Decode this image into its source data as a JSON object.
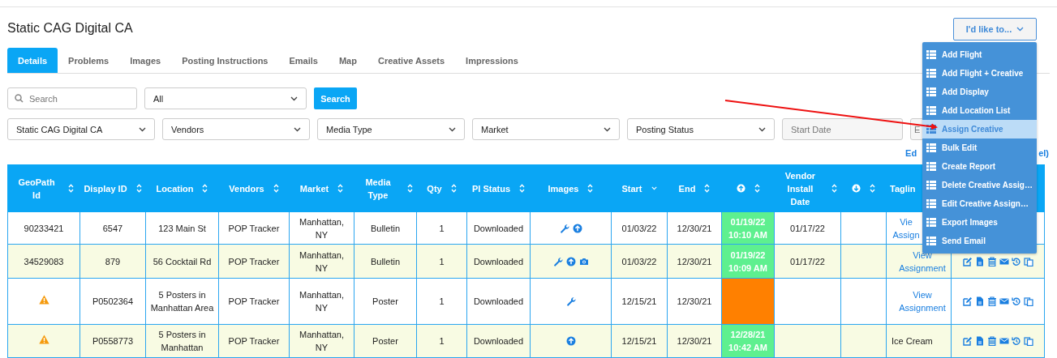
{
  "page_title": "Static CAG Digital CA",
  "action_menu": {
    "label": "I'd like to...",
    "items": [
      {
        "label": "Add Flight",
        "selected": false
      },
      {
        "label": "Add Flight + Creative",
        "selected": false
      },
      {
        "label": "Add Display",
        "selected": false
      },
      {
        "label": "Add Location List",
        "selected": false
      },
      {
        "label": "Assign Creative",
        "selected": true
      },
      {
        "label": "Bulk Edit",
        "selected": false
      },
      {
        "label": "Create Report",
        "selected": false
      },
      {
        "label": "Delete Creative Assig…",
        "selected": false
      },
      {
        "label": "Edit Creative Assign…",
        "selected": false
      },
      {
        "label": "Export Images",
        "selected": false
      },
      {
        "label": "Send Email",
        "selected": false
      }
    ]
  },
  "tabs": [
    {
      "label": "Details",
      "selected": true
    },
    {
      "label": "Problems",
      "selected": false
    },
    {
      "label": "Images",
      "selected": false
    },
    {
      "label": "Posting Instructions",
      "selected": false
    },
    {
      "label": "Emails",
      "selected": false
    },
    {
      "label": "Map",
      "selected": false
    },
    {
      "label": "Creative Assets",
      "selected": false
    },
    {
      "label": "Impressions",
      "selected": false
    }
  ],
  "search": {
    "placeholder": "Search",
    "scope": "All",
    "button": "Search"
  },
  "filters": [
    {
      "kind": "select",
      "value": "Static CAG Digital CA"
    },
    {
      "kind": "select",
      "value": "Vendors"
    },
    {
      "kind": "select",
      "value": "Media Type"
    },
    {
      "kind": "select",
      "value": "Market"
    },
    {
      "kind": "select",
      "value": "Posting Status"
    },
    {
      "kind": "date",
      "placeholder": "Start Date"
    },
    {
      "kind": "date",
      "placeholder": "E"
    }
  ],
  "links": [
    "Ed",
    "el)"
  ],
  "table": {
    "columns": [
      {
        "kind": "text",
        "label": "GeoPath Id",
        "sortable": true,
        "sorted": false
      },
      {
        "kind": "text",
        "label": "Display ID",
        "sortable": true,
        "sorted": false
      },
      {
        "kind": "text",
        "label": "Location",
        "sortable": true,
        "sorted": false
      },
      {
        "kind": "text",
        "label": "Vendors",
        "sortable": true,
        "sorted": false
      },
      {
        "kind": "text",
        "label": "Market",
        "sortable": true,
        "sorted": false
      },
      {
        "kind": "text",
        "label": "Media Type",
        "sortable": true,
        "sorted": false
      },
      {
        "kind": "text",
        "label": "Qty",
        "sortable": true,
        "sorted": false
      },
      {
        "kind": "text",
        "label": "PI Status",
        "sortable": true,
        "sorted": false
      },
      {
        "kind": "text",
        "label": "Images",
        "sortable": true,
        "sorted": false
      },
      {
        "kind": "text",
        "label": "Start",
        "sortable": true,
        "sorted": true
      },
      {
        "kind": "text",
        "label": "End",
        "sortable": true,
        "sorted": false
      },
      {
        "kind": "up",
        "sortable": true,
        "sorted": false
      },
      {
        "kind": "text",
        "label": "Vendor Install Date",
        "sortable": true,
        "sorted": false
      },
      {
        "kind": "down",
        "sortable": true,
        "sorted": false
      },
      {
        "kind": "text",
        "label": "Taglin",
        "sortable": false
      },
      {
        "kind": "blank",
        "sortable": false
      }
    ],
    "rows": [
      {
        "geopath_warning": false,
        "geopath_id": "90233421",
        "display_id": "6547",
        "location": "123 Main St",
        "vendor": "POP Tracker",
        "market": "Manhattan, NY",
        "media_type": "Bulletin",
        "qty": "1",
        "pi_status": "Downloaded",
        "images": {
          "wrench": true,
          "upload": true,
          "camera": false
        },
        "start": "01/03/22",
        "end": "12/30/21",
        "uploaded": {
          "text": "01/19/22 10:10 AM",
          "color": "#5ef08f"
        },
        "vendor_install": "01/17/22",
        "tagline": {
          "kind": "link",
          "text": "Vie Assign"
        },
        "actions": false
      },
      {
        "geopath_warning": false,
        "geopath_id": "34529083",
        "display_id": "879",
        "location": "56 Cocktail Rd",
        "vendor": "POP Tracker",
        "market": "Manhattan, NY",
        "media_type": "Bulletin",
        "qty": "1",
        "pi_status": "Downloaded",
        "images": {
          "wrench": true,
          "upload": true,
          "camera": true
        },
        "start": "01/03/22",
        "end": "12/30/21",
        "uploaded": {
          "text": "01/19/22 10:09 AM",
          "color": "#5ef08f"
        },
        "vendor_install": "01/17/22",
        "tagline": {
          "kind": "link",
          "text": "View Assignment"
        },
        "actions": true
      },
      {
        "geopath_warning": true,
        "display_id": "P0502364",
        "location": "5 Posters in Manhattan Area",
        "vendor": "POP Tracker",
        "market": "Manhattan, NY",
        "media_type": "Poster",
        "qty": "1",
        "pi_status": "Downloaded",
        "images": {
          "wrench": true,
          "upload": false,
          "camera": false
        },
        "start": "12/15/21",
        "end": "12/30/21",
        "uploaded": {
          "color": "#ff8000"
        },
        "tagline": {
          "kind": "link",
          "text": "View Assignment"
        },
        "actions": true
      },
      {
        "geopath_warning": true,
        "display_id": "P0558773",
        "location": "5 Posters in Manhattan",
        "vendor": "POP Tracker",
        "market": "Manhattan, NY",
        "media_type": "Poster",
        "qty": "1",
        "pi_status": "Downloaded",
        "images": {
          "wrench": false,
          "upload": true,
          "camera": false
        },
        "start": "12/15/21",
        "end": "12/30/21",
        "uploaded": {
          "text": "12/28/21 10:42 AM",
          "color": "#5ef08f"
        },
        "tagline": {
          "kind": "text",
          "text": "Ice Cream"
        },
        "actions": true
      }
    ]
  }
}
